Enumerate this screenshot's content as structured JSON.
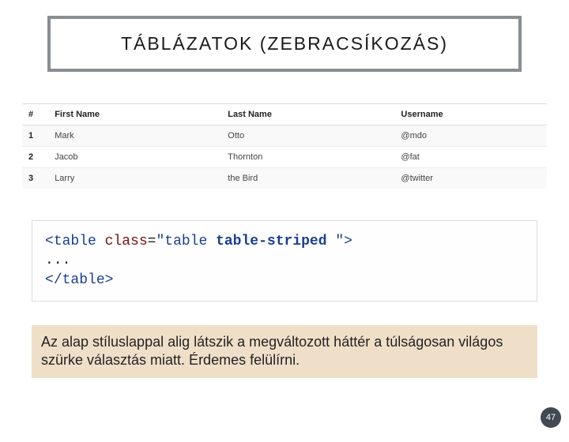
{
  "title": "TÁBLÁZATOK (ZEBRACSÍKOZÁS)",
  "table": {
    "headers": {
      "hash": "#",
      "first": "First Name",
      "last": "Last Name",
      "user": "Username"
    },
    "rows": [
      {
        "n": "1",
        "first": "Mark",
        "last": "Otto",
        "user": "@mdo"
      },
      {
        "n": "2",
        "first": "Jacob",
        "last": "Thornton",
        "user": "@fat"
      },
      {
        "n": "3",
        "first": "Larry",
        "last": "the Bird",
        "user": "@twitter"
      }
    ]
  },
  "code": {
    "open_lt": "<",
    "tag_table": "table",
    "sp_class": " class",
    "eq": "=",
    "q1": "\"",
    "cls_val": "table ",
    "cls_bold": "table-striped",
    "sp": " ",
    "q2": "\"",
    "close_gt": ">",
    "ellipsis": "...",
    "open_lt2": "<",
    "slash": "/",
    "tag_table2": "table",
    "close_gt2": ">"
  },
  "note_text": "Az alap stíluslappal alig látszik a megváltozott háttér a túlságosan világos szürke választás miatt. Érdemes felülírni.",
  "page_number": "47"
}
